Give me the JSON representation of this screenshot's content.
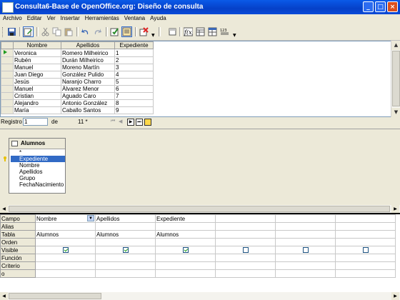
{
  "window": {
    "title": "Consulta6-Base de OpenOffice.org: Diseño de consulta",
    "min": "_",
    "max": "□",
    "close": "×"
  },
  "menu": [
    "Archivo",
    "Editar",
    "Ver",
    "Insertar",
    "Herramientas",
    "Ventana",
    "Ayuda"
  ],
  "toolbar_icons": [
    "save-icon",
    "edit-icon",
    "cut-icon",
    "copy-icon",
    "paste-icon",
    "undo-icon",
    "redo-icon",
    "run-query-icon",
    "sql-view-icon",
    "clear-query-icon",
    "add-table-icon",
    "functions-icon",
    "table-name-icon",
    "alias-icon",
    "distinct-values-icon",
    "limit-dropdown-icon"
  ],
  "grid": {
    "columns": [
      "Nombre",
      "Apellidos",
      "Expediente"
    ],
    "rows": [
      [
        "Veronica",
        "Romero Milheirico",
        "1"
      ],
      [
        "Rubén",
        "Durán Milheirico",
        "2"
      ],
      [
        "Manuel",
        "Moreno Martín",
        "3"
      ],
      [
        "Juan Diego",
        "González Pulido",
        "4"
      ],
      [
        "Jesús",
        "Naranjo Charro",
        "5"
      ],
      [
        "Manuel",
        "Álvarez Menor",
        "6"
      ],
      [
        "Cristian",
        "Aguado Caro",
        "7"
      ],
      [
        "Alejandro",
        "Antonio González",
        "8"
      ],
      [
        "María",
        "Caballo Santos",
        "9"
      ]
    ]
  },
  "recordbar": {
    "label": "Registro",
    "current": "1",
    "of": "de",
    "total": "11 *"
  },
  "table_window": {
    "title": "Alumnos",
    "fields": [
      "*",
      "Expediente",
      "Nombre",
      "Apellidos",
      "Grupo",
      "FechaNacimiento"
    ],
    "selected_index": 1
  },
  "criteria": {
    "row_labels": [
      "Campo",
      "Alias",
      "Tabla",
      "Orden",
      "Visible",
      "Función",
      "Criterio",
      "o"
    ],
    "columns": [
      {
        "campo": "Nombre",
        "tabla": "Alumnos",
        "visible": true
      },
      {
        "campo": "Apellidos",
        "tabla": "Alumnos",
        "visible": true
      },
      {
        "campo": "Expediente",
        "tabla": "Alumnos",
        "visible": true
      },
      {
        "campo": "",
        "tabla": "",
        "visible": false
      },
      {
        "campo": "",
        "tabla": "",
        "visible": false
      },
      {
        "campo": "",
        "tabla": "",
        "visible": false
      }
    ]
  },
  "colors": {
    "titlebar": "#0a5ae8",
    "selection": "#316ac5",
    "checkmark": "#21a121",
    "face": "#ece9d8"
  }
}
